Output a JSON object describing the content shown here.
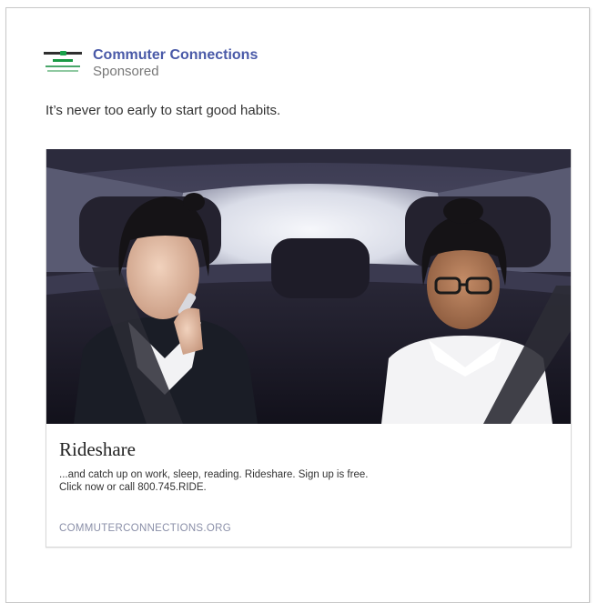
{
  "post": {
    "page_name": "Commuter Connections",
    "sponsored_label": "Sponsored",
    "message": "It’s never too early to start good habits.",
    "logo_icon": "commuter-connections-logo-icon"
  },
  "card": {
    "image_icon": "two-girls-in-car-photo",
    "title": "Rideshare",
    "description_line1": "...and catch up on work, sleep, reading. Rideshare. Sign up is free.",
    "description_line2": "Click now or call 800.745.RIDE.",
    "link_text": "COMMUTERCONNECTIONS.ORG"
  },
  "colors": {
    "page_name": "#4a5aa8",
    "link": "#8a8fa8"
  }
}
